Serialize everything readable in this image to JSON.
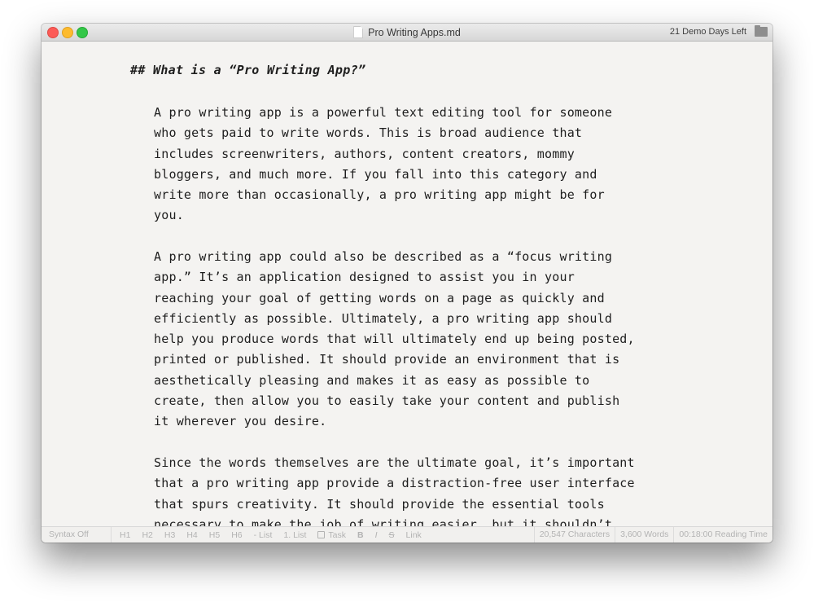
{
  "window": {
    "title": "Pro Writing Apps.md",
    "demo_notice": "21 Demo Days Left",
    "icons": {
      "file": "document-icon",
      "folder": "folder-icon"
    }
  },
  "editor": {
    "heading": "## What is a “Pro Writing App?”",
    "paragraphs": [
      "A pro writing app is a powerful text editing tool for someone\nwho gets paid to write words. This is broad audience that\nincludes screenwriters, authors, content creators, mommy\nbloggers, and much more. If you fall into this category and\nwrite more than occasionally, a pro writing app might be for\nyou.",
      "A pro writing app could also be described as a “focus writing\napp.” It’s an application designed to assist you in your\nreaching your goal of getting words on a page as quickly and\nefficiently as possible. Ultimately, a pro writing app should\nhelp you produce words that will ultimately end up being posted,\nprinted or published. It should provide an environment that is\naesthetically pleasing and makes it as easy as possible to\ncreate, then allow you to easily take your content and publish\nit wherever you desire.",
      "Since the words themselves are the ultimate goal, it’s important\nthat a pro writing app provide a distraction-free user interface\nthat spurs creativity. It should provide the essential tools\nnecessary to make the job of writing easier, but it shouldn’t"
    ]
  },
  "statusbar": {
    "syntax": "Syntax Off",
    "tools": {
      "h1": "H1",
      "h2": "H2",
      "h3": "H3",
      "h4": "H4",
      "h5": "H5",
      "h6": "H6",
      "bullet_list": "- List",
      "numbered_list": "1. List",
      "task": "Task",
      "bold": "B",
      "italic": "I",
      "strike": "S",
      "link": "Link"
    },
    "stats": {
      "characters": "20,547 Characters",
      "words": "3,600 Words",
      "reading_time": "00:18:00 Reading Time"
    }
  }
}
